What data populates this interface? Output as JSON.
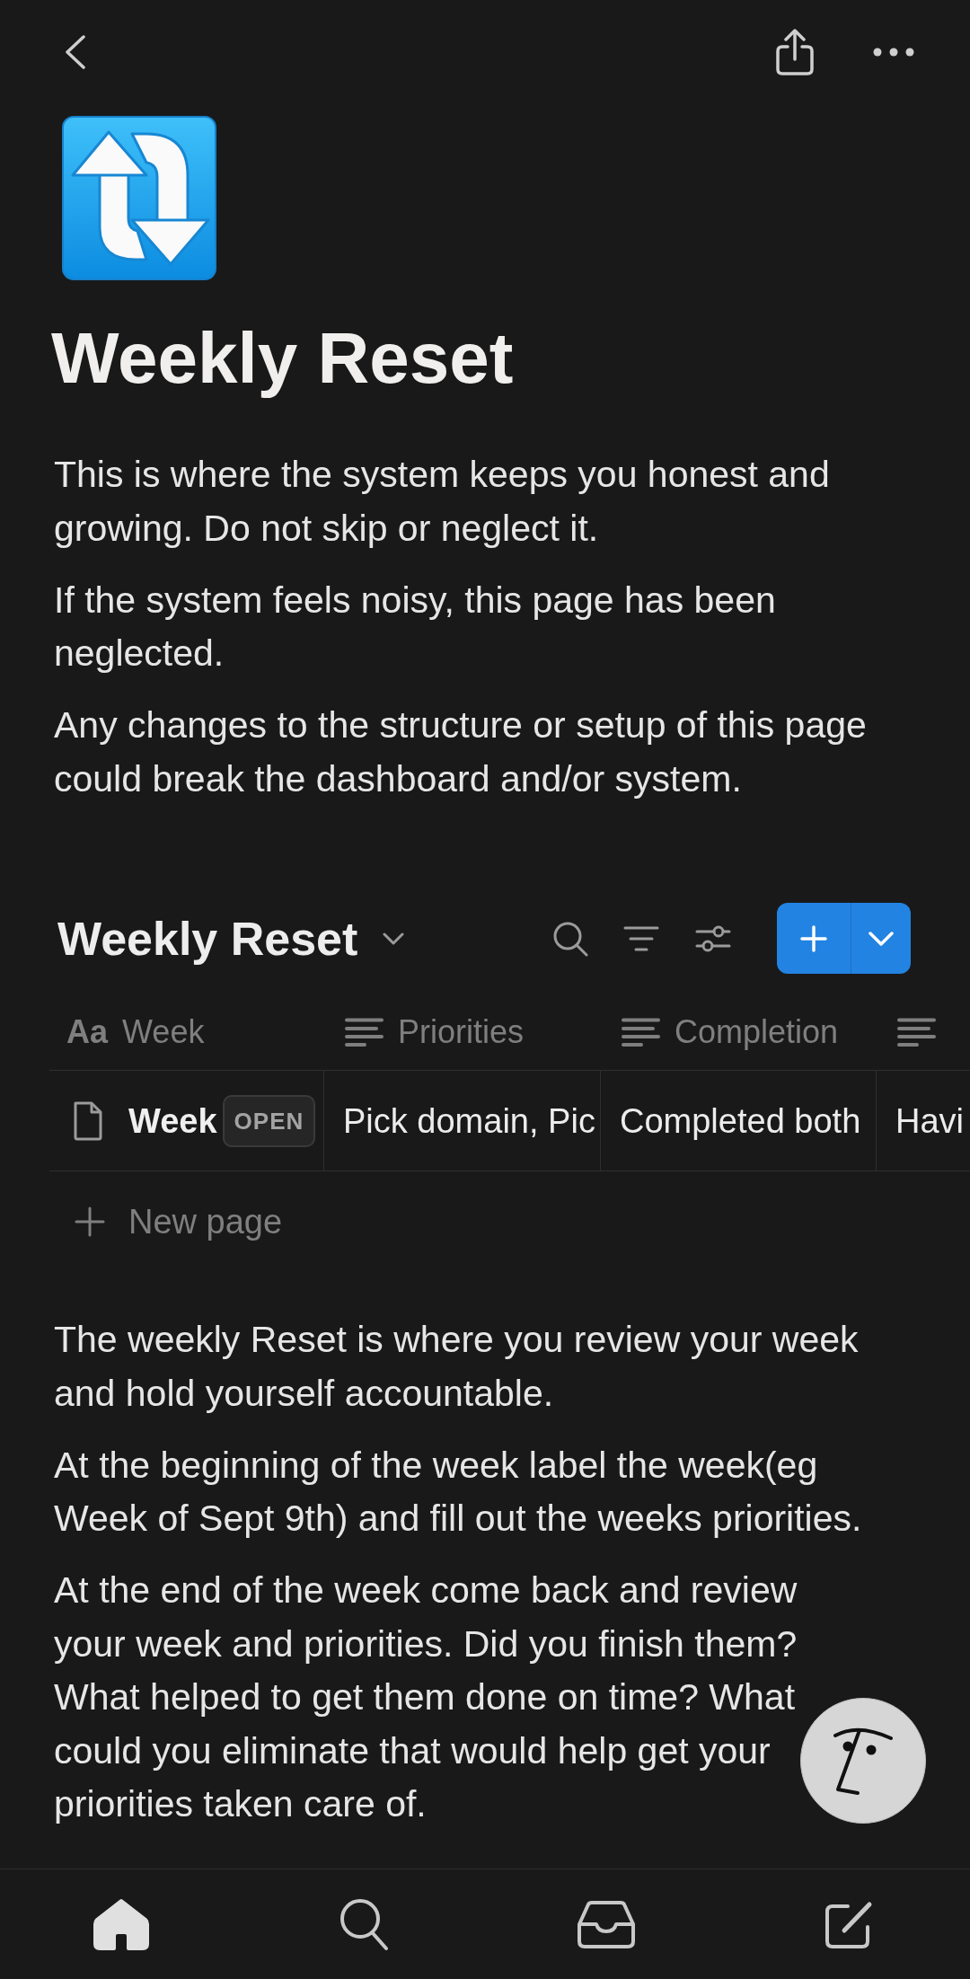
{
  "page": {
    "title": "Weekly Reset",
    "paragraphs": [
      "This is where the system keeps you honest and growing. Do not skip or neglect it.",
      "If the system feels noisy, this page has been neglected.",
      "Any changes to the structure or setup of this page could break the dashboard and/or system."
    ]
  },
  "database": {
    "title": "Weekly Reset",
    "columns": [
      {
        "kind": "title",
        "icon": "Aa",
        "name": "Week"
      },
      {
        "kind": "text",
        "name": "Priorities"
      },
      {
        "kind": "text",
        "name": "Completion"
      },
      {
        "kind": "text"
      }
    ],
    "rows": [
      {
        "cells": [
          "Week",
          "Pick domain, Pic",
          "Completed both",
          "Havi"
        ],
        "badge": "OPEN"
      }
    ],
    "new_row_label": "New page"
  },
  "notes": [
    "The weekly Reset is where you review your week and hold yourself accountable.",
    "At the beginning of the week label the week(eg Week of Sept 9th) and fill out the weeks priorities.",
    "At the end of the week come back and review your week and priorities. Did you finish them? What helped to get them done on time? What could you eliminate that would help get your priorities taken care of."
  ],
  "bottom_nav": [
    {
      "selected": true
    },
    {
      "selected": false
    },
    {
      "selected": false
    },
    {
      "selected": false
    }
  ]
}
